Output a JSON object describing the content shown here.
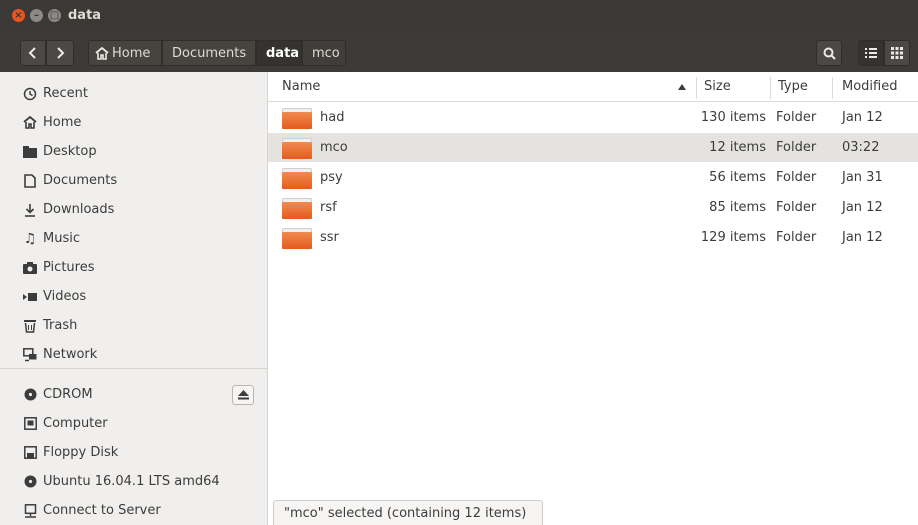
{
  "window": {
    "title": "data"
  },
  "toolbar": {
    "back_icon": "chevron-left-icon",
    "forward_icon": "chevron-right-icon",
    "breadcrumb": [
      {
        "label": "Home",
        "icon": "home-icon"
      },
      {
        "label": "Documents"
      },
      {
        "label": "data",
        "active": true
      },
      {
        "label": "mco"
      }
    ],
    "search_icon": "search-icon",
    "view_list_icon": "list-view-icon",
    "view_grid_icon": "grid-view-icon"
  },
  "sidebar": {
    "places": [
      {
        "label": "Recent",
        "icon": "clock-icon"
      },
      {
        "label": "Home",
        "icon": "home-icon"
      },
      {
        "label": "Desktop",
        "icon": "desktop-folder-icon"
      },
      {
        "label": "Documents",
        "icon": "document-icon"
      },
      {
        "label": "Downloads",
        "icon": "download-icon"
      },
      {
        "label": "Music",
        "icon": "music-icon"
      },
      {
        "label": "Pictures",
        "icon": "camera-icon"
      },
      {
        "label": "Videos",
        "icon": "video-icon"
      },
      {
        "label": "Trash",
        "icon": "trash-icon"
      },
      {
        "label": "Network",
        "icon": "network-icon"
      }
    ],
    "devices": [
      {
        "label": "CDROM",
        "icon": "disc-icon",
        "eject": true
      },
      {
        "label": "Computer",
        "icon": "computer-icon"
      },
      {
        "label": "Floppy Disk",
        "icon": "floppy-icon"
      },
      {
        "label": "Ubuntu 16.04.1 LTS amd64",
        "icon": "disc-icon"
      },
      {
        "label": "Connect to Server",
        "icon": "server-icon"
      }
    ]
  },
  "columns": {
    "name": "Name",
    "size": "Size",
    "type": "Type",
    "modified": "Modified",
    "sort_icon": "sort-ascending-icon"
  },
  "files": [
    {
      "name": "had",
      "size": "130 items",
      "type": "Folder",
      "modified": "Jan 12",
      "selected": false
    },
    {
      "name": "mco",
      "size": "12 items",
      "type": "Folder",
      "modified": "03:22",
      "selected": true
    },
    {
      "name": "psy",
      "size": "56 items",
      "type": "Folder",
      "modified": "Jan 31",
      "selected": false
    },
    {
      "name": "rsf",
      "size": "85 items",
      "type": "Folder",
      "modified": "Jan 12",
      "selected": false
    },
    {
      "name": "ssr",
      "size": "129 items",
      "type": "Folder",
      "modified": "Jan 12",
      "selected": false
    }
  ],
  "status": {
    "text": "\"mco\" selected  (containing 12 items)"
  },
  "colors": {
    "accent": "#e95420",
    "titlebar": "#3a3935",
    "sidebar": "#f0efee",
    "selection": "#e5e3df"
  }
}
